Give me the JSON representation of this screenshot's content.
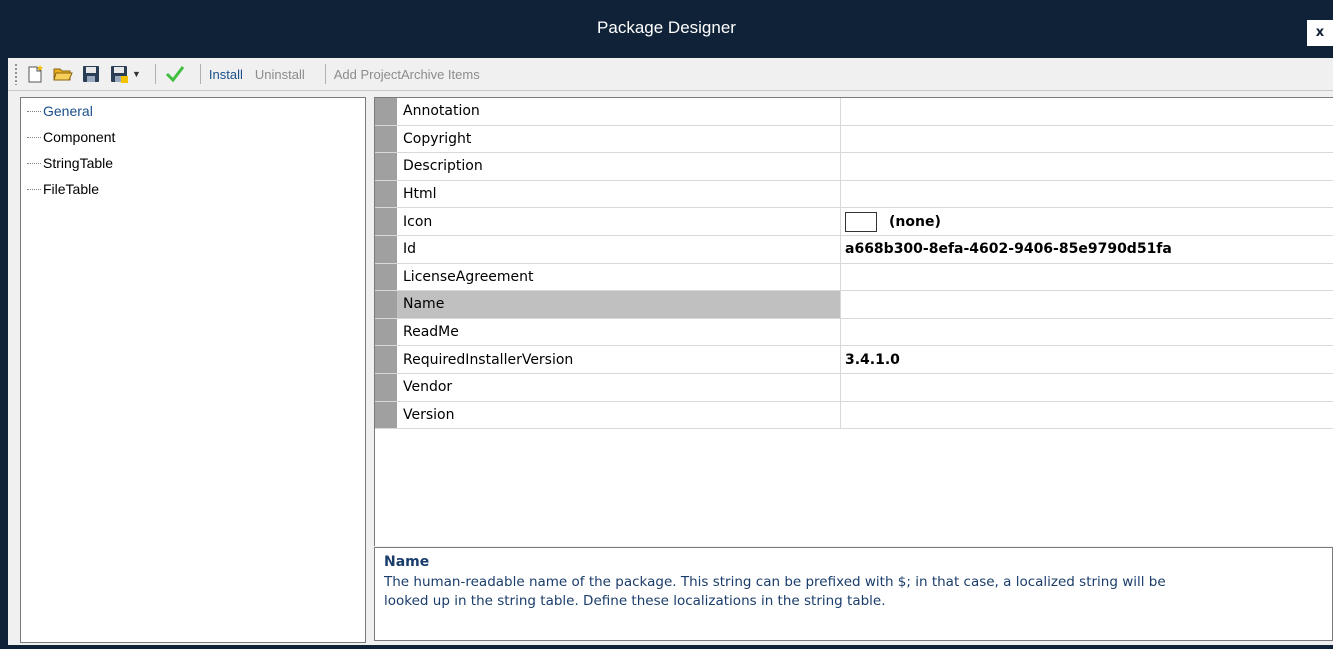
{
  "window": {
    "title": "Package Designer",
    "close_label": "x"
  },
  "toolbar": {
    "icons": [
      "new-icon",
      "open-folder-icon",
      "save-icon",
      "save-as-icon",
      "validate-check-icon"
    ],
    "install_label": "Install",
    "uninstall_label": "Uninstall",
    "add_archive_label": "Add ProjectArchive Items"
  },
  "tree": {
    "items": [
      {
        "label": "General",
        "selected": true
      },
      {
        "label": "Component"
      },
      {
        "label": "StringTable"
      },
      {
        "label": "FileTable"
      }
    ]
  },
  "properties": {
    "rows": [
      {
        "name": "Annotation",
        "value": ""
      },
      {
        "name": "Copyright",
        "value": ""
      },
      {
        "name": "Description",
        "value": ""
      },
      {
        "name": "Html",
        "value": ""
      },
      {
        "name": "Icon",
        "value": "(none)"
      },
      {
        "name": "Id",
        "value": "a668b300-8efa-4602-9406-85e9790d51fa"
      },
      {
        "name": "LicenseAgreement",
        "value": ""
      },
      {
        "name": "Name",
        "value": "",
        "selected": true
      },
      {
        "name": "ReadMe",
        "value": ""
      },
      {
        "name": "RequiredInstallerVersion",
        "value": "3.4.1.0"
      },
      {
        "name": "Vendor",
        "value": ""
      },
      {
        "name": "Version",
        "value": ""
      }
    ]
  },
  "description": {
    "title": "Name",
    "text": "The human-readable name of the package. This string can be prefixed with $; in that case, a localized string will be\nlooked up in the string table. Define these localizations in the string table."
  },
  "colors": {
    "titlebar": "#0f2238",
    "link": "#1a4f8a",
    "check": "#3fbf3f",
    "selected_row": "#c0c0c0"
  }
}
